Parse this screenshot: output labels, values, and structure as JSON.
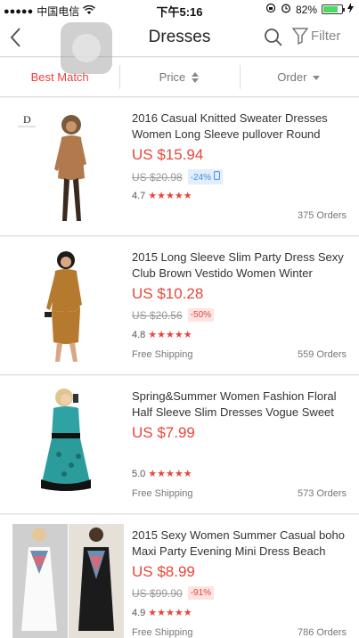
{
  "status": {
    "signal": "●●●●●",
    "carrier": "中国电信",
    "time": "下午5:16",
    "battery": "82%",
    "battery_level": 0.82
  },
  "nav": {
    "title": "Dresses",
    "filter_label": "Filter"
  },
  "sort": {
    "best_match": "Best Match",
    "price": "Price",
    "order": "Order"
  },
  "products": [
    {
      "title": "2016 Casual Knitted Sweater Dresses Women Long Sleeve pullover Round",
      "price": "US $15.94",
      "orig": "US $20.98",
      "discount": "-24%",
      "rating": "4.7",
      "shipping": "",
      "orders": "375 Orders"
    },
    {
      "title": "2015 Long Sleeve Slim Party Dress Sexy Club Brown Vestido Women Winter",
      "price": "US $10.28",
      "orig": "US $20.56",
      "discount": "-50%",
      "rating": "4.8",
      "shipping": "Free Shipping",
      "orders": "559 Orders"
    },
    {
      "title": "Spring&Summer Women Fashion Floral Half Sleeve Slim Dresses Vogue Sweet",
      "price": "US $7.99",
      "orig": "",
      "discount": "",
      "rating": "5.0",
      "shipping": "Free Shipping",
      "orders": "573 Orders"
    },
    {
      "title": "2015 Sexy Women Summer Casual boho Maxi Party Evening Mini Dress Beach",
      "price": "US $8.99",
      "orig": "US $99.90",
      "discount": "-91%",
      "rating": "4.9",
      "shipping": "Free Shipping",
      "orders": "786 Orders"
    }
  ],
  "colors": {
    "accent": "#e8463a",
    "mobile_badge": "#3a8ee8",
    "battery": "#4cd964"
  }
}
